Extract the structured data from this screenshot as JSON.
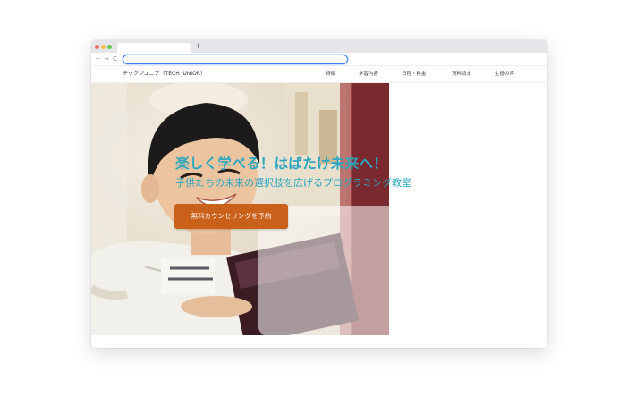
{
  "browser": {
    "new_tab_label": "+",
    "nav": {
      "back": "←",
      "forward": "→",
      "reload": "C"
    },
    "url": ""
  },
  "site": {
    "brand": "テックジュニア（TECH JUNIOR）",
    "menu": [
      "特徴",
      "学習内容",
      "日程・料金",
      "資料請求",
      "生徒の声"
    ]
  },
  "hero": {
    "title": "楽しく学べる！はばたけ未来へ！",
    "subtitle": "子供たちの未来の選択肢を広げるプログラミング教室",
    "cta_label": "無料カウンセリングを予約"
  },
  "colors": {
    "accent": "#2aa6bf",
    "cta": "#c9611a",
    "url_focus": "#3b82f6"
  }
}
